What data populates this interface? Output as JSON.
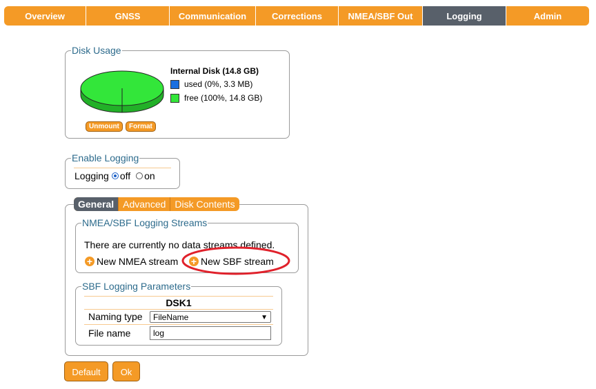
{
  "nav": {
    "tabs": [
      {
        "label": "Overview"
      },
      {
        "label": "GNSS"
      },
      {
        "label": "Communication"
      },
      {
        "label": "Corrections"
      },
      {
        "label": "NMEA/SBF Out"
      },
      {
        "label": "Logging"
      },
      {
        "label": "Admin"
      }
    ],
    "active": "Logging"
  },
  "disk_usage": {
    "legend": "Disk Usage",
    "disk_name": "Internal Disk (14.8 GB)",
    "used_label": "used (0%, 3.3 MB)",
    "free_label": "free (100%, 14.8 GB)",
    "used_percent": 0,
    "used_color": "#1a6fe0",
    "free_color": "#33e63a",
    "unmount_label": "Unmount",
    "format_label": "Format"
  },
  "enable_logging": {
    "legend": "Enable Logging",
    "label": "Logging",
    "options": [
      "off",
      "on"
    ],
    "selected": "off"
  },
  "subtabs": [
    "General",
    "Advanced",
    "Disk Contents"
  ],
  "streams": {
    "legend": "NMEA/SBF Logging Streams",
    "message": "There are currently no data streams defined.",
    "new_nmea": "New NMEA stream",
    "new_sbf": "New SBF stream"
  },
  "sbf_params": {
    "legend": "SBF Logging Parameters",
    "disk": "DSK1",
    "naming_type_label": "Naming type",
    "naming_type_value": "FileName",
    "file_name_label": "File name",
    "file_name_value": "log"
  },
  "buttons": {
    "default": "Default",
    "ok": "Ok"
  },
  "colors": {
    "accent": "#f49a26",
    "active_tab": "#58606a",
    "legend_text": "#2d6b8c",
    "annotation": "#e0212b"
  }
}
